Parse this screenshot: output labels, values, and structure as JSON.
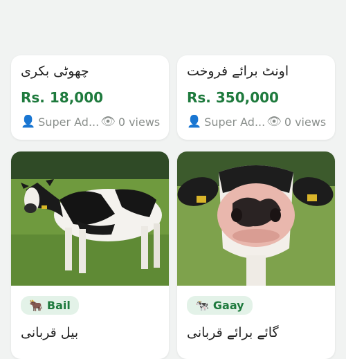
{
  "listings": [
    {
      "title": "چھوٹی بکری",
      "price": "Rs. 18,000",
      "seller": "Super Ad...",
      "views": "0 views"
    },
    {
      "title": "اونٹ برائے فروخت",
      "price": "Rs. 350,000",
      "seller": "Super Ad...",
      "views": "0 views"
    },
    {
      "category": "Bail",
      "category_icon": "ox-icon",
      "title": "بیل قربانی"
    },
    {
      "category": "Gaay",
      "category_icon": "cow-icon",
      "title": "گائے برائے قربانی"
    }
  ],
  "colors": {
    "price": "#1e7a3d",
    "badge_bg": "#e3f2e8",
    "page_bg": "#f1f3f2"
  }
}
